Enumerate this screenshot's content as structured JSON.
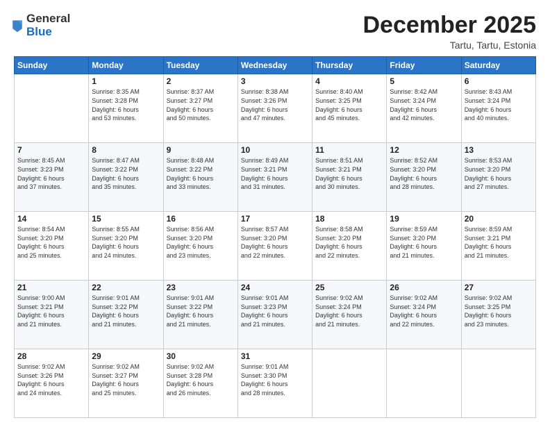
{
  "logo": {
    "general": "General",
    "blue": "Blue"
  },
  "header": {
    "month": "December 2025",
    "location": "Tartu, Tartu, Estonia"
  },
  "weekdays": [
    "Sunday",
    "Monday",
    "Tuesday",
    "Wednesday",
    "Thursday",
    "Friday",
    "Saturday"
  ],
  "weeks": [
    [
      {
        "day": "",
        "info": ""
      },
      {
        "day": "1",
        "info": "Sunrise: 8:35 AM\nSunset: 3:28 PM\nDaylight: 6 hours\nand 53 minutes."
      },
      {
        "day": "2",
        "info": "Sunrise: 8:37 AM\nSunset: 3:27 PM\nDaylight: 6 hours\nand 50 minutes."
      },
      {
        "day": "3",
        "info": "Sunrise: 8:38 AM\nSunset: 3:26 PM\nDaylight: 6 hours\nand 47 minutes."
      },
      {
        "day": "4",
        "info": "Sunrise: 8:40 AM\nSunset: 3:25 PM\nDaylight: 6 hours\nand 45 minutes."
      },
      {
        "day": "5",
        "info": "Sunrise: 8:42 AM\nSunset: 3:24 PM\nDaylight: 6 hours\nand 42 minutes."
      },
      {
        "day": "6",
        "info": "Sunrise: 8:43 AM\nSunset: 3:24 PM\nDaylight: 6 hours\nand 40 minutes."
      }
    ],
    [
      {
        "day": "7",
        "info": "Sunrise: 8:45 AM\nSunset: 3:23 PM\nDaylight: 6 hours\nand 37 minutes."
      },
      {
        "day": "8",
        "info": "Sunrise: 8:47 AM\nSunset: 3:22 PM\nDaylight: 6 hours\nand 35 minutes."
      },
      {
        "day": "9",
        "info": "Sunrise: 8:48 AM\nSunset: 3:22 PM\nDaylight: 6 hours\nand 33 minutes."
      },
      {
        "day": "10",
        "info": "Sunrise: 8:49 AM\nSunset: 3:21 PM\nDaylight: 6 hours\nand 31 minutes."
      },
      {
        "day": "11",
        "info": "Sunrise: 8:51 AM\nSunset: 3:21 PM\nDaylight: 6 hours\nand 30 minutes."
      },
      {
        "day": "12",
        "info": "Sunrise: 8:52 AM\nSunset: 3:20 PM\nDaylight: 6 hours\nand 28 minutes."
      },
      {
        "day": "13",
        "info": "Sunrise: 8:53 AM\nSunset: 3:20 PM\nDaylight: 6 hours\nand 27 minutes."
      }
    ],
    [
      {
        "day": "14",
        "info": "Sunrise: 8:54 AM\nSunset: 3:20 PM\nDaylight: 6 hours\nand 25 minutes."
      },
      {
        "day": "15",
        "info": "Sunrise: 8:55 AM\nSunset: 3:20 PM\nDaylight: 6 hours\nand 24 minutes."
      },
      {
        "day": "16",
        "info": "Sunrise: 8:56 AM\nSunset: 3:20 PM\nDaylight: 6 hours\nand 23 minutes."
      },
      {
        "day": "17",
        "info": "Sunrise: 8:57 AM\nSunset: 3:20 PM\nDaylight: 6 hours\nand 22 minutes."
      },
      {
        "day": "18",
        "info": "Sunrise: 8:58 AM\nSunset: 3:20 PM\nDaylight: 6 hours\nand 22 minutes."
      },
      {
        "day": "19",
        "info": "Sunrise: 8:59 AM\nSunset: 3:20 PM\nDaylight: 6 hours\nand 21 minutes."
      },
      {
        "day": "20",
        "info": "Sunrise: 8:59 AM\nSunset: 3:21 PM\nDaylight: 6 hours\nand 21 minutes."
      }
    ],
    [
      {
        "day": "21",
        "info": "Sunrise: 9:00 AM\nSunset: 3:21 PM\nDaylight: 6 hours\nand 21 minutes."
      },
      {
        "day": "22",
        "info": "Sunrise: 9:01 AM\nSunset: 3:22 PM\nDaylight: 6 hours\nand 21 minutes."
      },
      {
        "day": "23",
        "info": "Sunrise: 9:01 AM\nSunset: 3:22 PM\nDaylight: 6 hours\nand 21 minutes."
      },
      {
        "day": "24",
        "info": "Sunrise: 9:01 AM\nSunset: 3:23 PM\nDaylight: 6 hours\nand 21 minutes."
      },
      {
        "day": "25",
        "info": "Sunrise: 9:02 AM\nSunset: 3:24 PM\nDaylight: 6 hours\nand 21 minutes."
      },
      {
        "day": "26",
        "info": "Sunrise: 9:02 AM\nSunset: 3:24 PM\nDaylight: 6 hours\nand 22 minutes."
      },
      {
        "day": "27",
        "info": "Sunrise: 9:02 AM\nSunset: 3:25 PM\nDaylight: 6 hours\nand 23 minutes."
      }
    ],
    [
      {
        "day": "28",
        "info": "Sunrise: 9:02 AM\nSunset: 3:26 PM\nDaylight: 6 hours\nand 24 minutes."
      },
      {
        "day": "29",
        "info": "Sunrise: 9:02 AM\nSunset: 3:27 PM\nDaylight: 6 hours\nand 25 minutes."
      },
      {
        "day": "30",
        "info": "Sunrise: 9:02 AM\nSunset: 3:28 PM\nDaylight: 6 hours\nand 26 minutes."
      },
      {
        "day": "31",
        "info": "Sunrise: 9:01 AM\nSunset: 3:30 PM\nDaylight: 6 hours\nand 28 minutes."
      },
      {
        "day": "",
        "info": ""
      },
      {
        "day": "",
        "info": ""
      },
      {
        "day": "",
        "info": ""
      }
    ]
  ]
}
